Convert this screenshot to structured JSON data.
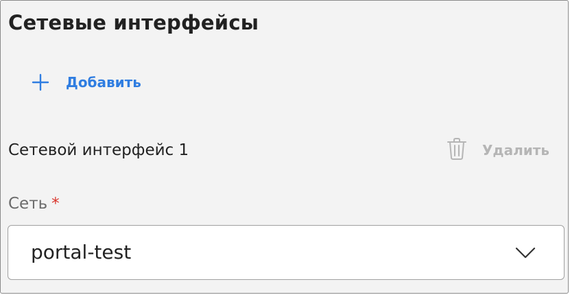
{
  "section": {
    "title": "Сетевые интерфейсы"
  },
  "add_button": {
    "icon": "plus-icon",
    "label": "Добавить"
  },
  "interface": {
    "title": "Сетевой интерфейс 1",
    "delete_button": {
      "icon": "trash-icon",
      "label": "Удалить"
    }
  },
  "network_field": {
    "label": "Сеть",
    "required_mark": "*",
    "value": "portal-test",
    "dropdown_icon": "chevron-down-icon"
  },
  "colors": {
    "accent": "#2f7de1",
    "required": "#d9342b",
    "disabled": "#b5b5b5",
    "panel_background": "#f3f3f3"
  }
}
